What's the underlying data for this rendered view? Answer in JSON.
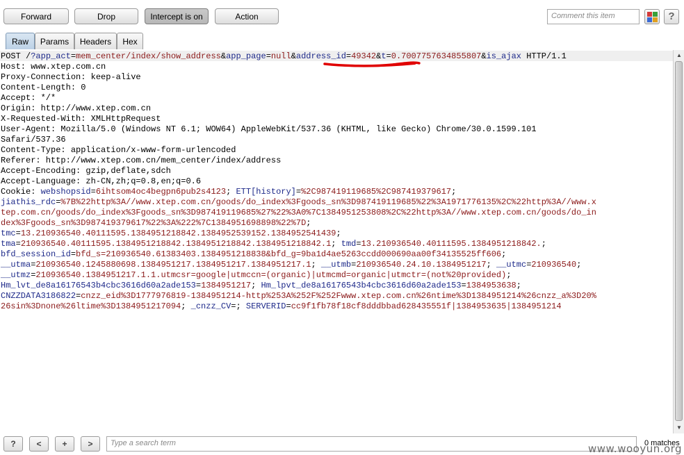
{
  "toolbar": {
    "forward_label": "Forward",
    "drop_label": "Drop",
    "intercept_label": "Intercept is on",
    "action_label": "Action",
    "comment_placeholder": "Comment this item",
    "help_label": "?",
    "highlight_colors": [
      "#d43a3a",
      "#3aa03a",
      "#3a6ad4",
      "#e0a020"
    ]
  },
  "tabs": [
    {
      "label": "Raw",
      "active": true
    },
    {
      "label": "Params",
      "active": false
    },
    {
      "label": "Headers",
      "active": false
    },
    {
      "label": "Hex",
      "active": false
    }
  ],
  "request": {
    "lines": [
      [
        [
          "a",
          "POST /"
        ],
        [
          "k",
          "?app_act"
        ],
        [
          "a",
          "="
        ],
        [
          "v",
          "mem_center/index/show_address"
        ],
        [
          "a",
          "&"
        ],
        [
          "k",
          "app_page"
        ],
        [
          "a",
          "="
        ],
        [
          "v",
          "null"
        ],
        [
          "a",
          "&"
        ],
        [
          "k",
          "address_id"
        ],
        [
          "a",
          "="
        ],
        [
          "v",
          "49342"
        ],
        [
          "a",
          "&"
        ],
        [
          "k",
          "t"
        ],
        [
          "a",
          "="
        ],
        [
          "v",
          "0.7007757634855807"
        ],
        [
          "a",
          "&"
        ],
        [
          "k",
          "is_ajax"
        ],
        [
          "a",
          " HTTP/1.1"
        ]
      ],
      [
        [
          "a",
          "Host: www.xtep.com.cn"
        ]
      ],
      [
        [
          "a",
          "Proxy-Connection: keep-alive"
        ]
      ],
      [
        [
          "a",
          "Content-Length: 0"
        ]
      ],
      [
        [
          "a",
          "Accept: */*"
        ]
      ],
      [
        [
          "a",
          "Origin: http://www.xtep.com.cn"
        ]
      ],
      [
        [
          "a",
          "X-Requested-With: XMLHttpRequest"
        ]
      ],
      [
        [
          "a",
          "User-Agent: Mozilla/5.0 (Windows NT 6.1; WOW64) AppleWebKit/537.36 (KHTML, like Gecko) Chrome/30.0.1599.101"
        ]
      ],
      [
        [
          "a",
          "Safari/537.36"
        ]
      ],
      [
        [
          "a",
          "Content-Type: application/x-www-form-urlencoded"
        ]
      ],
      [
        [
          "a",
          "Referer: http://www.xtep.com.cn/mem_center/index/address"
        ]
      ],
      [
        [
          "a",
          "Accept-Encoding: gzip,deflate,sdch"
        ]
      ],
      [
        [
          "a",
          "Accept-Language: zh-CN,zh;q=0.8,en;q=0.6"
        ]
      ],
      [
        [
          "a",
          "Cookie: "
        ],
        [
          "k",
          "webshopsid"
        ],
        [
          "a",
          "="
        ],
        [
          "v",
          "6ihtsom4oc4begpn6pub2s4123"
        ],
        [
          "a",
          "; "
        ],
        [
          "k",
          "ETT[history]"
        ],
        [
          "a",
          "="
        ],
        [
          "v",
          "%2C987419119685%2C987419379617"
        ],
        [
          "a",
          ";"
        ]
      ],
      [
        [
          "k",
          "jiathis_rdc"
        ],
        [
          "a",
          "="
        ],
        [
          "v",
          "%7B%22http%3A//www.xtep.com.cn/goods/do_index%3Fgoods_sn%3D987419119685%22%3A1971776135%2C%22http%3A//www.x"
        ]
      ],
      [
        [
          "v",
          "tep.com.cn/goods/do_index%3Fgoods_sn%3D987419119685%27%22%3A0%7C1384951253808%2C%22http%3A//www.xtep.com.cn/goods/do_in"
        ]
      ],
      [
        [
          "v",
          "dex%3Fgoods_sn%3D987419379617%22%3A%222%7C1384951698898%22%7D"
        ],
        [
          "a",
          ";"
        ]
      ],
      [
        [
          "k",
          "tmc"
        ],
        [
          "a",
          "="
        ],
        [
          "v",
          "13.210936540.40111595.1384951218842.1384952539152.1384952541439"
        ],
        [
          "a",
          ";"
        ]
      ],
      [
        [
          "k",
          "tma"
        ],
        [
          "a",
          "="
        ],
        [
          "v",
          "210936540.40111595.1384951218842.1384951218842.1384951218842.1"
        ],
        [
          "a",
          "; "
        ],
        [
          "k",
          "tmd"
        ],
        [
          "a",
          "="
        ],
        [
          "v",
          "13.210936540.40111595.1384951218842."
        ],
        [
          "a",
          ";"
        ]
      ],
      [
        [
          "k",
          "bfd_session_id"
        ],
        [
          "a",
          "="
        ],
        [
          "v",
          "bfd_s=210936540.61383403.1384951218838&bfd_g=9ba1d4ae5263ccdd000690aa00f34135525ff606"
        ],
        [
          "a",
          ";"
        ]
      ],
      [
        [
          "k",
          "__utma"
        ],
        [
          "a",
          "="
        ],
        [
          "v",
          "210936540.1245880698.1384951217.1384951217.1384951217.1"
        ],
        [
          "a",
          "; "
        ],
        [
          "k",
          "__utmb"
        ],
        [
          "a",
          "="
        ],
        [
          "v",
          "210936540.24.10.1384951217"
        ],
        [
          "a",
          "; "
        ],
        [
          "k",
          "__utmc"
        ],
        [
          "a",
          "="
        ],
        [
          "v",
          "210936540"
        ],
        [
          "a",
          ";"
        ]
      ],
      [
        [
          "k",
          "__utmz"
        ],
        [
          "a",
          "="
        ],
        [
          "v",
          "210936540.1384951217.1.1.utmcsr=google|utmccn=(organic)|utmcmd=organic|utmctr=(not%20provided)"
        ],
        [
          "a",
          ";"
        ]
      ],
      [
        [
          "k",
          "Hm_lvt_de8a16176543b4cbc3616d60a2ade153"
        ],
        [
          "a",
          "="
        ],
        [
          "v",
          "1384951217"
        ],
        [
          "a",
          "; "
        ],
        [
          "k",
          "Hm_lpvt_de8a16176543b4cbc3616d60a2ade153"
        ],
        [
          "a",
          "="
        ],
        [
          "v",
          "1384953638"
        ],
        [
          "a",
          ";"
        ]
      ],
      [
        [
          "k",
          "CNZZDATA3186822"
        ],
        [
          "a",
          "="
        ],
        [
          "v",
          "cnzz_eid%3D1777976819-1384951214-http%253A%252F%252Fwww.xtep.com.cn%26ntime%3D1384951214%26cnzz_a%3D20%"
        ]
      ],
      [
        [
          "v",
          "26sin%3Dnone%26ltime%3D1384951217094"
        ],
        [
          "a",
          "; "
        ],
        [
          "k",
          "_cnzz_CV"
        ],
        [
          "a",
          "="
        ],
        [
          "v",
          ""
        ],
        [
          "a",
          "; "
        ],
        [
          "k",
          "SERVERID"
        ],
        [
          "a",
          "="
        ],
        [
          "v",
          "cc9f1fb78f18cf8dddbbad628435551f|1384953635|1384951214"
        ]
      ]
    ]
  },
  "search": {
    "help_label": "?",
    "prev_label": "<",
    "add_label": "+",
    "next_label": ">",
    "placeholder": "Type a search term",
    "matches": "0 matches"
  },
  "watermark": "www.wooyun.org"
}
